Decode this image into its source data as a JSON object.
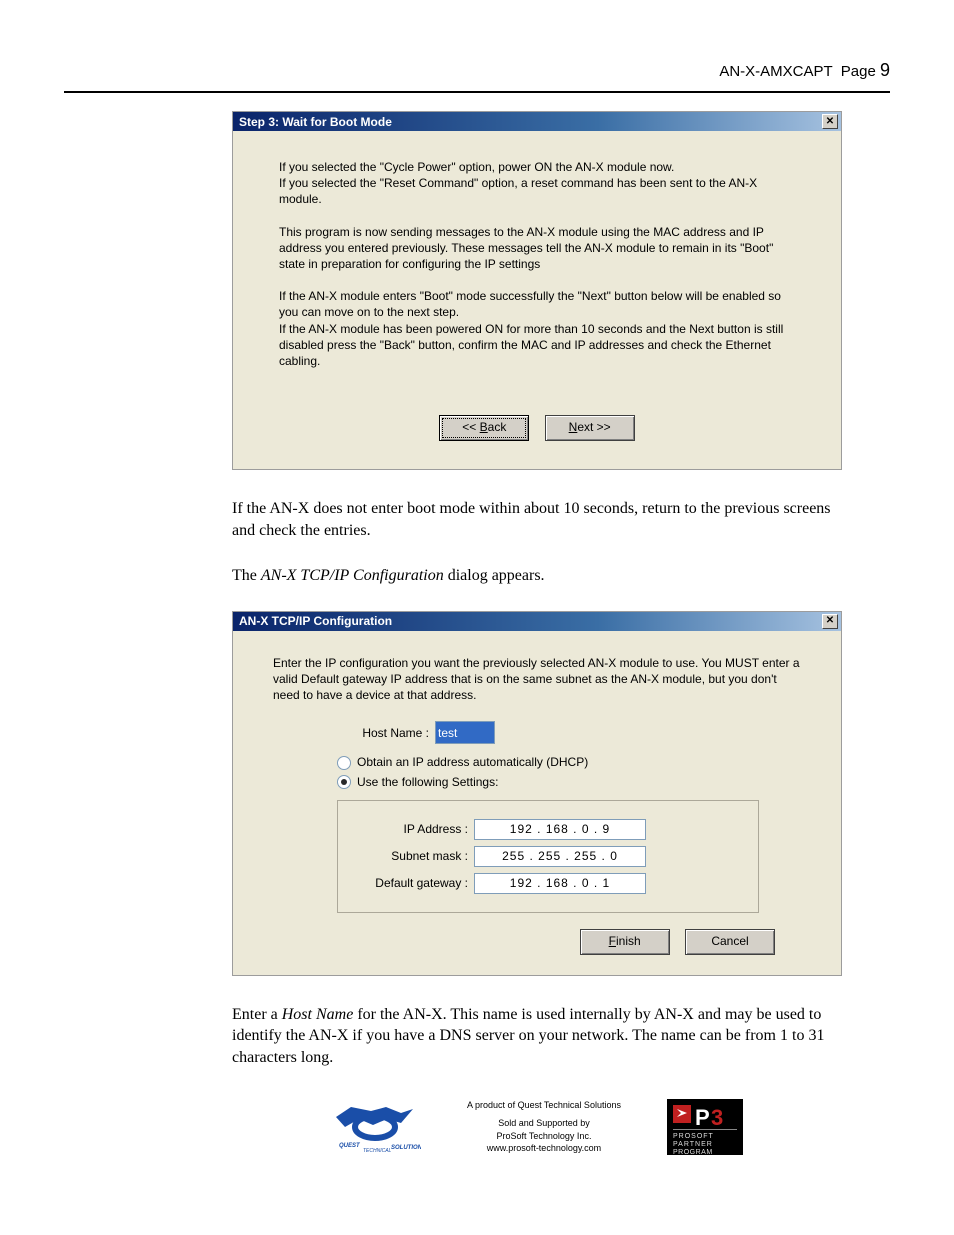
{
  "header": {
    "doc_id": "AN-X-AMXCAPT",
    "page_label": "Page",
    "page_num": "9"
  },
  "dialog1": {
    "title": "Step 3: Wait for Boot Mode",
    "p1": "If you selected the \"Cycle Power\" option, power ON the AN-X module now.\nIf you selected the \"Reset Command\" option, a reset command has been sent to the AN-X module.",
    "p2": "This program is now sending messages to the AN-X module using the MAC address and IP address you entered previously. These messages tell the AN-X module to remain in its \"Boot\" state in preparation for configuring the IP settings",
    "p3": "If the AN-X module enters \"Boot\" mode successfully the \"Next\" button below will be enabled so you can move on to the next step.\nIf the AN-X module has been powered ON for more than 10 seconds and the Next button is still disabled press the \"Back\" button, confirm the MAC and IP addresses and check the Ethernet cabling.",
    "back": "<< Back",
    "next": "Next >>"
  },
  "para1": "If the AN-X does not enter boot mode within about 10 seconds, return to the previous screens and check the entries.",
  "para2_pre": "The ",
  "para2_em": "AN-X TCP/IP Configuration",
  "para2_post": " dialog appears.",
  "dialog2": {
    "title": "AN-X TCP/IP Configuration",
    "intro": "Enter the IP configuration you want the previously selected AN-X module to use. You MUST enter a valid Default gateway IP address that is on the same subnet as the AN-X module, but you don't need to have a device at that address.",
    "host_label": "Host Name :",
    "host_value": "test",
    "radio_dhcp": "Obtain an IP address automatically (DHCP)",
    "radio_static": "Use the following Settings:",
    "ip_label": "IP Address :",
    "ip_value": "192  .  168  .    0  .    9",
    "mask_label": "Subnet mask :",
    "mask_value": "255  .  255  .  255  .    0",
    "gw_label": "Default gateway :",
    "gw_value": "192  .  168  .    0  .    1",
    "finish": "Finish",
    "cancel": "Cancel"
  },
  "para3_a": "Enter a ",
  "para3_em": "Host Name",
  "para3_b": " for the AN-X.  This name is used internally by AN-X and may be used to identify the AN-X if you have a DNS server on your network.  The name can be from 1 to 31 characters long.",
  "footer": {
    "line1": "A product of Quest Technical Solutions",
    "line2": "Sold and Supported by",
    "line3": "ProSoft Technology Inc.",
    "line4": "www.prosoft-technology.com"
  }
}
